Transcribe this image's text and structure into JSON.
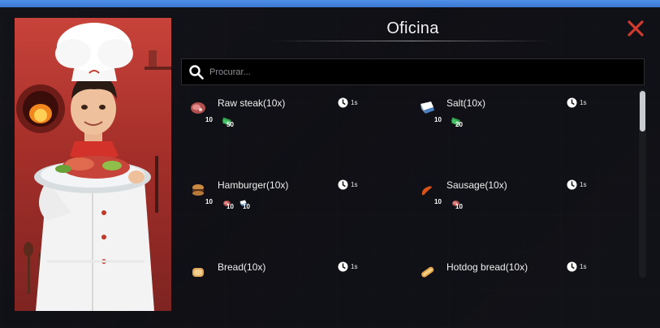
{
  "window": {
    "title": "Oficina"
  },
  "search": {
    "placeholder": "Procurar..."
  },
  "colors": {
    "close": "#d13a2e",
    "accent_blue": "#3a78d2",
    "meat": "#b0504f",
    "bread": "#d9a055",
    "salt": "#8fb0cf",
    "money": "#2f9e4d"
  },
  "recipes": [
    {
      "name": "Raw steak(10x)",
      "time": "1s",
      "icon": "steak-icon",
      "qty": "10",
      "ingredients": [
        {
          "icon": "money-icon",
          "qty": "50"
        }
      ]
    },
    {
      "name": "Salt(10x)",
      "time": "1s",
      "icon": "salt-icon",
      "qty": "10",
      "ingredients": [
        {
          "icon": "money-icon",
          "qty": "20"
        }
      ]
    },
    {
      "name": "Hamburger(10x)",
      "time": "1s",
      "icon": "hamburger-icon",
      "qty": "10",
      "ingredients": [
        {
          "icon": "steak-icon",
          "qty": "10"
        },
        {
          "icon": "salt-icon",
          "qty": "10"
        }
      ]
    },
    {
      "name": "Sausage(10x)",
      "time": "1s",
      "icon": "sausage-icon",
      "qty": "10",
      "ingredients": [
        {
          "icon": "steak-icon",
          "qty": "10"
        }
      ]
    },
    {
      "name": "Bread(10x)",
      "time": "1s",
      "icon": "bread-icon",
      "qty": "",
      "ingredients": []
    },
    {
      "name": "Hotdog bread(10x)",
      "time": "1s",
      "icon": "hotdog-bread-icon",
      "qty": "",
      "ingredients": []
    }
  ]
}
